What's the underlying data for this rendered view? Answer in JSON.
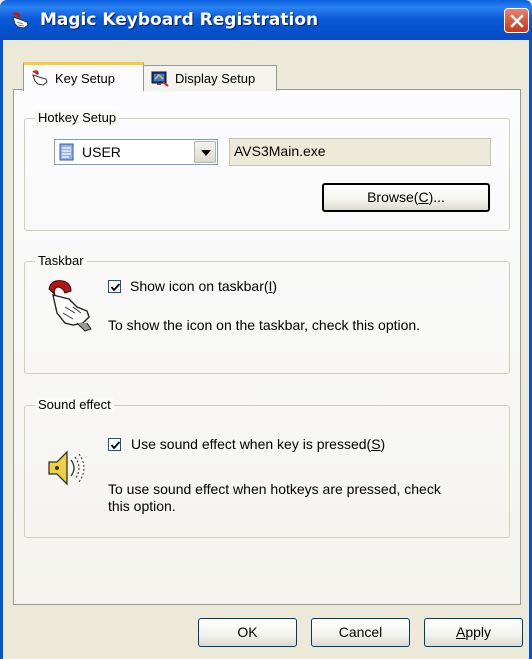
{
  "window": {
    "title": "Magic Keyboard Registration",
    "app_icon": "magic-keyboard-hand-icon",
    "close_icon": "close-icon"
  },
  "tabs": [
    {
      "label": "Key Setup",
      "icon": "hand-icon",
      "active": true
    },
    {
      "label": "Display Setup",
      "icon": "display-icon",
      "active": false
    }
  ],
  "hotkey_setup": {
    "title": "Hotkey Setup",
    "user_combo": {
      "value": "USER",
      "icon": "document-icon"
    },
    "program_path": "AVS3Main.exe",
    "browse_button": {
      "label": "Browse(",
      "hotkey": "C",
      "suffix": ")..."
    }
  },
  "taskbar": {
    "title": "Taskbar",
    "icon": "hand-pointer-icon",
    "checkbox": {
      "label": "Show icon on taskbar(",
      "hotkey": "I",
      "suffix": ")",
      "checked": true
    },
    "description": "To show the icon on the taskbar, check this option."
  },
  "sound_effect": {
    "title": "Sound effect",
    "icon": "speaker-icon",
    "checkbox": {
      "label": "Use sound effect when key is pressed(",
      "hotkey": "S",
      "suffix": ")",
      "checked": true
    },
    "description_line1": "To use sound effect when hotkeys are pressed, check",
    "description_line2": "this option."
  },
  "footer": {
    "ok_label": "OK",
    "cancel_label": "Cancel",
    "apply_label": "pply",
    "apply_hotkey": "A"
  },
  "colors": {
    "titlebar": "#0553d2",
    "face": "#ece9d8",
    "tab_highlight": "#ffc83c",
    "close_button": "#d85a3f"
  }
}
